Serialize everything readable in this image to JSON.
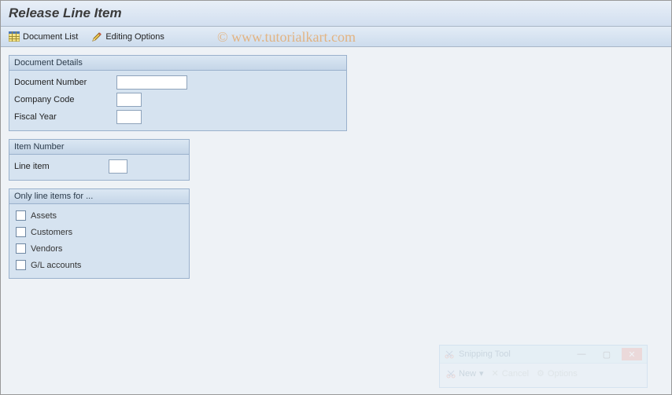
{
  "header": {
    "title": "Release Line Item"
  },
  "toolbar": {
    "doc_list_label": "Document List",
    "edit_opts_label": "Editing Options"
  },
  "watermark": {
    "text": "© www.tutorialkart.com"
  },
  "groups": {
    "document_details": {
      "title": "Document Details",
      "fields": {
        "doc_number_label": "Document Number",
        "doc_number_value": "",
        "company_code_label": "Company Code",
        "company_code_value": "",
        "fiscal_year_label": "Fiscal Year",
        "fiscal_year_value": ""
      }
    },
    "item_number": {
      "title": "Item Number",
      "fields": {
        "line_item_label": "Line item",
        "line_item_value": ""
      }
    },
    "only_items": {
      "title": "Only line items for ...",
      "options": {
        "assets": "Assets",
        "customers": "Customers",
        "vendors": "Vendors",
        "gl_accounts": "G/L accounts"
      }
    }
  },
  "snipping_tool": {
    "title": "Snipping Tool",
    "new_label": "New",
    "cancel_label": "Cancel",
    "options_label": "Options"
  }
}
